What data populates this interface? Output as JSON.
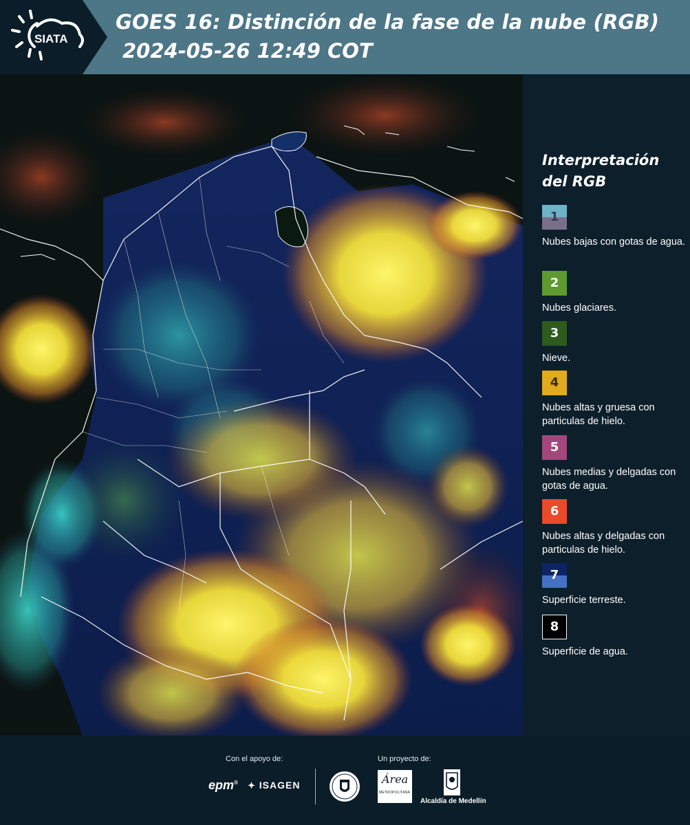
{
  "header": {
    "logo_text": "SIATA",
    "title": "GOES 16: Distinción de la fase de la nube (RGB)",
    "subtitle": "2024-05-26 12:49 COT"
  },
  "legend": {
    "title": "Interpretación del RGB",
    "items": [
      {
        "number": "1",
        "label": "Nubes bajas con gotas de agua.",
        "color_top": "#6fb3c8",
        "color_bottom": "#7a6f8a"
      },
      {
        "number": "2",
        "label": "Nubes glaciares.",
        "color": "#5e9a2f"
      },
      {
        "number": "3",
        "label": "Nieve.",
        "color": "#2e5a1e"
      },
      {
        "number": "4",
        "label": "Nubes altas y gruesa con particulas de hielo.",
        "color": "#e0ac1e"
      },
      {
        "number": "5",
        "label": "Nubes medias y delgadas con gotas de agua.",
        "color": "#a2467c"
      },
      {
        "number": "6",
        "label": "Nubes altas y delgadas con particulas de hielo.",
        "color": "#e84a2a"
      },
      {
        "number": "7",
        "label": "Superficie terreste.",
        "color_top": "#0e2364",
        "color_bottom": "#4471c4"
      },
      {
        "number": "8",
        "label": "Superficie de agua.",
        "color": "#000000"
      }
    ]
  },
  "footer": {
    "support_label": "Con el apoyo de:",
    "project_label": "Un proyecto de:",
    "epm": "epm",
    "isagen": "ISAGEN",
    "area_metro": "Área",
    "area_metro_sub": "METROPOLITANA",
    "alcaldia": "Alcaldía de Medellín"
  },
  "colors": {
    "header_band": "#4d7687",
    "background": "#0d1f2b",
    "cloud_yellow": "#f2e94a",
    "land_blue": "#16287a",
    "low_cloud_cyan": "#3ad0c6"
  }
}
